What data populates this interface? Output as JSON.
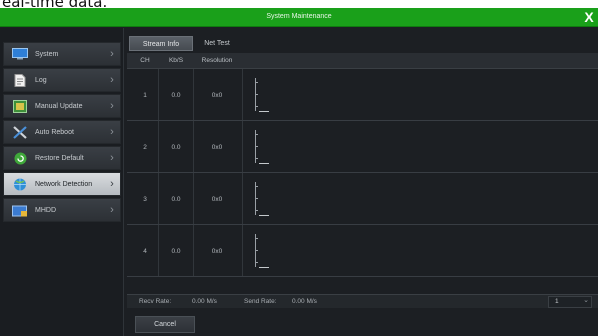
{
  "caption_fragment": "eal-time data.",
  "window": {
    "title": "System Maintenance",
    "close_symbol": "X"
  },
  "sidebar": {
    "items": [
      {
        "label": "System",
        "icon": "monitor-icon",
        "active": false
      },
      {
        "label": "Log",
        "icon": "document-icon",
        "active": false
      },
      {
        "label": "Manual Update",
        "icon": "update-icon",
        "active": false
      },
      {
        "label": "Auto Reboot",
        "icon": "tools-icon",
        "active": false
      },
      {
        "label": "Restore Default",
        "icon": "restore-icon",
        "active": false
      },
      {
        "label": "Network Detection",
        "icon": "globe-icon",
        "active": true
      },
      {
        "label": "MHDD",
        "icon": "disk-icon",
        "active": false
      }
    ]
  },
  "tabs": [
    {
      "label": "Stream Info",
      "active": true
    },
    {
      "label": "Net Test",
      "active": false
    }
  ],
  "table": {
    "headers": [
      "CH",
      "Kb/S",
      "Resolution"
    ],
    "rows": [
      {
        "ch": "1",
        "kbs": "0.0",
        "resolution": "0x0"
      },
      {
        "ch": "2",
        "kbs": "0.0",
        "resolution": "0x0"
      },
      {
        "ch": "3",
        "kbs": "0.0",
        "resolution": "0x0"
      },
      {
        "ch": "4",
        "kbs": "0.0",
        "resolution": "0x0"
      }
    ]
  },
  "status": {
    "recv_label": "Recv Rate:",
    "recv_value": "0.00 M/s",
    "send_label": "Send Rate:",
    "send_value": "0.00 M/s",
    "page_value": "1",
    "dropdown_symbol": "⌄"
  },
  "buttons": {
    "cancel": "Cancel"
  },
  "colors": {
    "titlebar": "#1aa01a",
    "panel_bg": "#1c1f23",
    "active_item": "#c8ccd0"
  }
}
